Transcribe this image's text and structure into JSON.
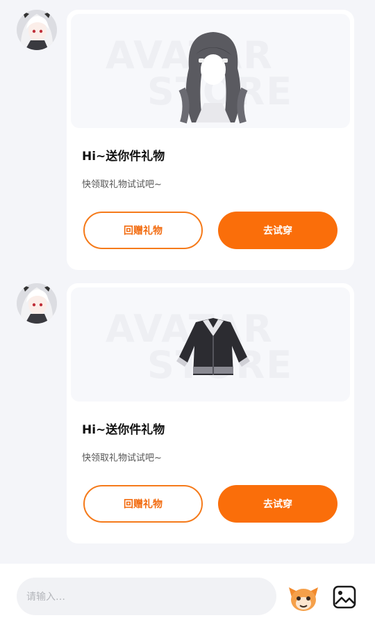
{
  "messages": [
    {
      "watermark_line1": "AVATAR",
      "watermark_line2": "STORE",
      "item": "hair",
      "title": "Hi~送你件礼物",
      "subtitle": "快领取礼物试试吧~",
      "return_gift_label": "回赠礼物",
      "try_on_label": "去试穿"
    },
    {
      "watermark_line1": "AVATAR",
      "watermark_line2": "STORE",
      "item": "jacket",
      "title": "Hi~送你件礼物",
      "subtitle": "快领取礼物试试吧~",
      "return_gift_label": "回赠礼物",
      "try_on_label": "去试穿"
    }
  ],
  "input": {
    "placeholder": "请输入…"
  },
  "icons": {
    "mascot": "emoji-mascot-icon",
    "image": "image-icon"
  },
  "colors": {
    "accent": "#fa6e0a",
    "background": "#f4f5f9",
    "card": "#ffffff"
  }
}
